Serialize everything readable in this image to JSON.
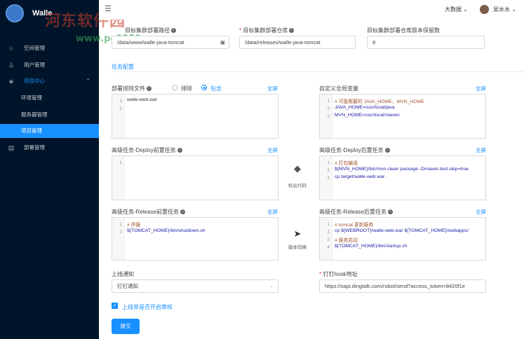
{
  "app": {
    "name": "Walle"
  },
  "watermark": {
    "text": "河东软件园",
    "site": "www.pc0359.cn"
  },
  "sidebar": {
    "items": [
      {
        "label": "空间管理"
      },
      {
        "label": "用户管理"
      },
      {
        "label": "项目中心"
      },
      {
        "label": "环境管理"
      },
      {
        "label": "服务器管理"
      },
      {
        "label": "项目管理"
      },
      {
        "label": "部署管理"
      }
    ]
  },
  "topbar": {
    "fold_icon": "menu-fold-icon",
    "language": "大数据",
    "user": "吴水水"
  },
  "form": {
    "deploy_path_label": "目标集群部署路径",
    "deploy_path_value": "/data/www/walle-java-tomcat",
    "repo_label": "目标集群部署仓库",
    "repo_value": "/data/releases/walle-java-tomcat",
    "keep_label": "目标集群部署仓库版本保留数",
    "keep_value": "8",
    "section_title": "任务配置",
    "exclude_label": "部署排除文件",
    "radio_exclude": "排除",
    "radio_include": "包含",
    "fullscreen": "全屏",
    "exclude_code": [
      "walle-web.war",
      ""
    ],
    "global_vars_label": "自定义全局变量",
    "global_vars_code": [
      "# 可能需要的 JAVA_HOME、MVN_HOME",
      "JAVA_HOME=/usr/local/java",
      "MVN_HOME=/usr/local/maven"
    ],
    "pre_deploy_label": "高级任务-Deploy前置任务",
    "pre_deploy_code": [
      ""
    ],
    "post_deploy_label": "高级任务-Deploy后置任务",
    "post_deploy_code": [
      "# 打包编译",
      "${MVN_HOME}/bin/mvn clean package -Dmaven.test.skip=true",
      "cp target/walle-web.war ."
    ],
    "checkout_label": "检出代码",
    "pre_release_label": "高级任务-Release前置任务",
    "pre_release_code": [
      "# 停服",
      "${TOMCAT_HOME}/bin/shutdown.sh"
    ],
    "post_release_label": "高级任务-Release后置任务",
    "post_release_code": [
      "# tomcat 更新服务",
      "cp ${WEBROOT}/walle-web.war ${TOMCAT_HOME}/webapps/",
      "# 服务启动",
      "${TOMCAT_HOME}/bin/startup.sh"
    ],
    "switch_label": "版本切换",
    "notify_label": "上线通知",
    "notify_value": "钉钉通知",
    "hook_label": "钉钉hook地址",
    "hook_value": "https://oapi.dingtalk.com/robot/send?access_token=8420f1e",
    "audit_label": "上线单是否开启审核",
    "submit_label": "提交"
  },
  "colors": {
    "accent": "#1890ff",
    "sidebar_bg": "#001529"
  }
}
